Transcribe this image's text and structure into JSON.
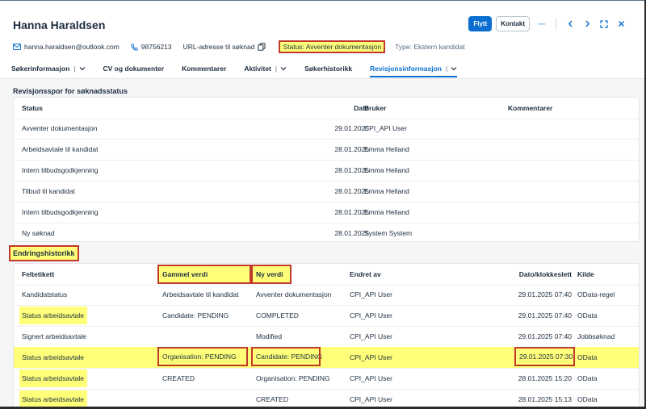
{
  "header": {
    "title": "Hanna Haraldsen",
    "email": "hanna.haraldsen@outlook.com",
    "phone": "98756213",
    "url_label": "URL-adresse til søknad",
    "status": "Status: Avventer dokumentasjon",
    "type": "Type: Ekstern kandidat",
    "move_label": "Flytt",
    "contact_label": "Kontakt",
    "more_label": "···"
  },
  "tabs": [
    {
      "label": "Søkerinformasjon"
    },
    {
      "label": "CV og dokumenter"
    },
    {
      "label": "Kommentarer"
    },
    {
      "label": "Aktivitet"
    },
    {
      "label": "Søkerhistorikk"
    },
    {
      "label": "Revisjonsinformasjon"
    }
  ],
  "audit": {
    "title": "Revisjonsspor for søknadsstatus",
    "columns": {
      "status": "Status",
      "date": "Dato",
      "user": "Bruker",
      "comments": "Kommentarer"
    },
    "rows": [
      {
        "status": "Avventer dokumentasjon",
        "date": "29.01.2025",
        "user": "CPI_API User"
      },
      {
        "status": "Arbeidsavtale til kandidat",
        "date": "28.01.2025",
        "user": "Emma Helland"
      },
      {
        "status": "Intern tilbudsgodkjenning",
        "date": "28.01.2025",
        "user": "Emma Helland"
      },
      {
        "status": "Tilbud til kandidat",
        "date": "28.01.2025",
        "user": "Emma Helland"
      },
      {
        "status": "Intern tilbudsgodkjenning",
        "date": "28.01.2025",
        "user": "Emma Helland"
      },
      {
        "status": "Ny søknad",
        "date": "28.01.2025",
        "user": "System System"
      }
    ]
  },
  "changes": {
    "title": "Endringshistorikk",
    "columns": {
      "field": "Feltetikett",
      "old": "Gammel verdi",
      "new": "Ny verdi",
      "changed_by": "Endret av",
      "datetime": "Dato/klokkeslett",
      "source": "Kilde"
    },
    "rows": [
      {
        "field": "Kandidatstatus",
        "old": "Arbeidsavtale til kandidat",
        "new": "Avventer dokumentasjon",
        "changed_by": "CPI_API User",
        "datetime": "29.01.2025 07:40",
        "source": "OData-regel"
      },
      {
        "field": "Status arbeidsavtale",
        "old": "Candidate: PENDING",
        "new": "COMPLETED",
        "changed_by": "CPI_API User",
        "datetime": "29.01.2025 07:40",
        "source": "OData"
      },
      {
        "field": "Signert arbeidsavtale",
        "old": "",
        "new": "Modified",
        "changed_by": "CPI_API User",
        "datetime": "29.01.2025 07:40",
        "source": "Jobbsøknad"
      },
      {
        "field": "Status arbeidsavtale",
        "old": "Organisation: PENDING",
        "new": "Candidate: PENDING",
        "changed_by": "CPI_API User",
        "datetime": "29.01.2025 07:30",
        "source": "OData"
      },
      {
        "field": "Status arbeidsavtale",
        "old": "CREATED",
        "new": "Organisation: PENDING",
        "changed_by": "CPI_API User",
        "datetime": "28.01.2025 15:20",
        "source": "OData"
      },
      {
        "field": "Status arbeidsavtale",
        "old": "",
        "new": "CREATED",
        "changed_by": "CPI_API User",
        "datetime": "28.01.2025 15:13",
        "source": "OData"
      }
    ]
  },
  "colors": {
    "accent": "#0a6ed1",
    "highlight": "#ffff7a",
    "annotation_border": "#c0392b"
  }
}
